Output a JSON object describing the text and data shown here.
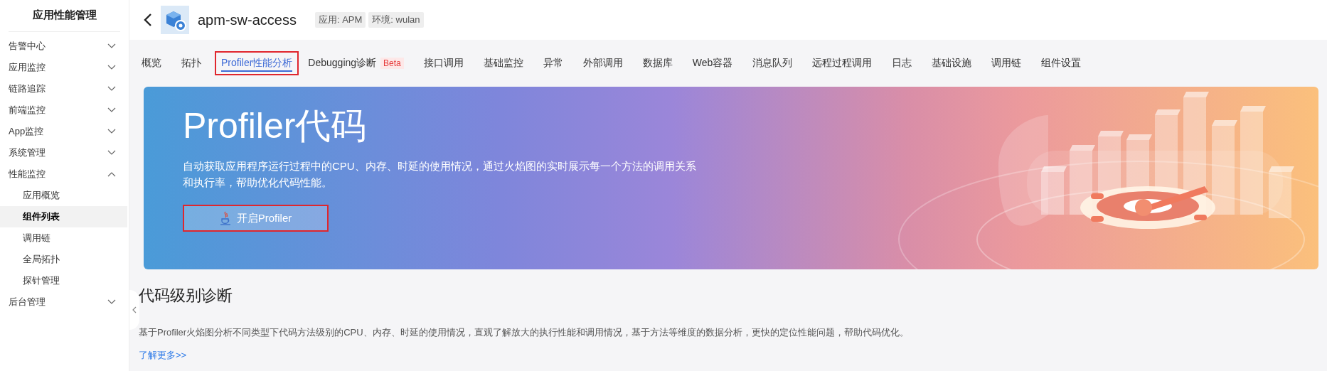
{
  "sidebar": {
    "title": "应用性能管理",
    "items": [
      {
        "label": "告警中心",
        "expanded": false
      },
      {
        "label": "应用监控",
        "expanded": false
      },
      {
        "label": "链路追踪",
        "expanded": false
      },
      {
        "label": "前端监控",
        "expanded": false
      },
      {
        "label": "App监控",
        "expanded": false
      },
      {
        "label": "系统管理",
        "expanded": false
      },
      {
        "label": "性能监控",
        "expanded": true,
        "children": [
          {
            "label": "应用概览",
            "selected": false
          },
          {
            "label": "组件列表",
            "selected": true
          },
          {
            "label": "调用链",
            "selected": false
          },
          {
            "label": "全局拓扑",
            "selected": false
          },
          {
            "label": "探针管理",
            "selected": false
          }
        ]
      },
      {
        "label": "后台管理",
        "expanded": false
      }
    ]
  },
  "header": {
    "title": "apm-sw-access",
    "tags": [
      "应用: APM",
      "环境: wulan"
    ]
  },
  "tabs": [
    {
      "label": "概览",
      "selected": false,
      "highlighted": false
    },
    {
      "label": "拓扑",
      "selected": false,
      "highlighted": false
    },
    {
      "label": "Profiler性能分析",
      "selected": true,
      "highlighted": true
    },
    {
      "label": "Debugging诊断",
      "selected": false,
      "highlighted": false,
      "badge": "Beta"
    },
    {
      "label": "接口调用",
      "selected": false,
      "highlighted": false
    },
    {
      "label": "基础监控",
      "selected": false,
      "highlighted": false
    },
    {
      "label": "异常",
      "selected": false,
      "highlighted": false
    },
    {
      "label": "外部调用",
      "selected": false,
      "highlighted": false
    },
    {
      "label": "数据库",
      "selected": false,
      "highlighted": false
    },
    {
      "label": "Web容器",
      "selected": false,
      "highlighted": false
    },
    {
      "label": "消息队列",
      "selected": false,
      "highlighted": false
    },
    {
      "label": "远程过程调用",
      "selected": false,
      "highlighted": false
    },
    {
      "label": "日志",
      "selected": false,
      "highlighted": false
    },
    {
      "label": "基础设施",
      "selected": false,
      "highlighted": false
    },
    {
      "label": "调用链",
      "selected": false,
      "highlighted": false
    },
    {
      "label": "组件设置",
      "selected": false,
      "highlighted": false
    }
  ],
  "banner": {
    "title": "Profiler代码",
    "description": "自动获取应用程序运行过程中的CPU、内存、时延的使用情况，通过火焰图的实时展示每一个方法的调用关系和执行率，帮助优化代码性能。",
    "button": {
      "label": "开启Profiler",
      "highlighted": true
    }
  },
  "section": {
    "heading": "代码级别诊断",
    "text": "基于Profiler火焰图分析不同类型下代码方法级别的CPU、内存、时延的使用情况，直观了解放大的执行性能和调用情况，基于方法等维度的数据分析，更快的定位性能问题，帮助代码优化。",
    "link": "了解更多>>"
  }
}
